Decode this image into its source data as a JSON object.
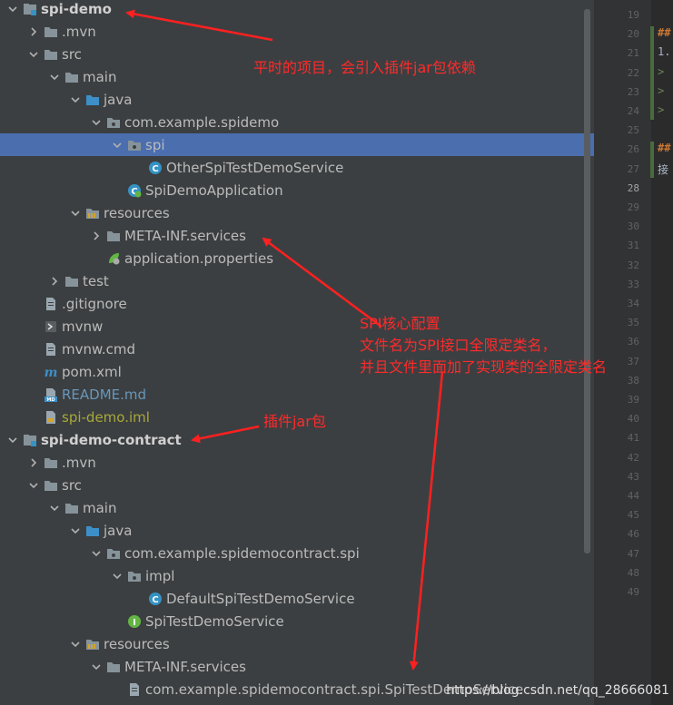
{
  "tree": {
    "rows": [
      {
        "label": "spi-demo",
        "kind": "module",
        "arrow": "down",
        "indent": 0,
        "style": "bold"
      },
      {
        "label": ".mvn",
        "kind": "folder",
        "arrow": "right",
        "indent": 1
      },
      {
        "label": "src",
        "kind": "folder",
        "arrow": "down",
        "indent": 1
      },
      {
        "label": "main",
        "kind": "folder",
        "arrow": "down",
        "indent": 2
      },
      {
        "label": "java",
        "kind": "src-folder",
        "arrow": "down",
        "indent": 3
      },
      {
        "label": "com.example.spidemo",
        "kind": "package",
        "arrow": "down",
        "indent": 4
      },
      {
        "label": "spi",
        "kind": "package",
        "arrow": "down",
        "indent": 5,
        "selected": true
      },
      {
        "label": "OtherSpiTestDemoService",
        "kind": "class",
        "arrow": "none",
        "indent": 6
      },
      {
        "label": "SpiDemoApplication",
        "kind": "app-class",
        "arrow": "none",
        "indent": 5
      },
      {
        "label": "resources",
        "kind": "res-folder",
        "arrow": "down",
        "indent": 3
      },
      {
        "label": "META-INF.services",
        "kind": "folder",
        "arrow": "right",
        "indent": 4
      },
      {
        "label": "application.properties",
        "kind": "properties",
        "arrow": "none",
        "indent": 4
      },
      {
        "label": "test",
        "kind": "folder",
        "arrow": "right",
        "indent": 2
      },
      {
        "label": ".gitignore",
        "kind": "file",
        "arrow": "none",
        "indent": 1
      },
      {
        "label": "mvnw",
        "kind": "script",
        "arrow": "none",
        "indent": 1
      },
      {
        "label": "mvnw.cmd",
        "kind": "file",
        "arrow": "none",
        "indent": 1
      },
      {
        "label": "pom.xml",
        "kind": "maven",
        "arrow": "none",
        "indent": 1
      },
      {
        "label": "README.md",
        "kind": "markdown",
        "arrow": "none",
        "indent": 1,
        "style": "blue"
      },
      {
        "label": "spi-demo.iml",
        "kind": "iml",
        "arrow": "none",
        "indent": 1,
        "style": "olive"
      },
      {
        "label": "spi-demo-contract",
        "kind": "module",
        "arrow": "down",
        "indent": 0,
        "style": "bold"
      },
      {
        "label": ".mvn",
        "kind": "folder",
        "arrow": "right",
        "indent": 1
      },
      {
        "label": "src",
        "kind": "folder",
        "arrow": "down",
        "indent": 1
      },
      {
        "label": "main",
        "kind": "folder",
        "arrow": "down",
        "indent": 2
      },
      {
        "label": "java",
        "kind": "src-folder",
        "arrow": "down",
        "indent": 3
      },
      {
        "label": "com.example.spidemocontract.spi",
        "kind": "package",
        "arrow": "down",
        "indent": 4
      },
      {
        "label": "impl",
        "kind": "package",
        "arrow": "down",
        "indent": 5
      },
      {
        "label": "DefaultSpiTestDemoService",
        "kind": "class",
        "arrow": "none",
        "indent": 6
      },
      {
        "label": "SpiTestDemoService",
        "kind": "interface",
        "arrow": "none",
        "indent": 5
      },
      {
        "label": "resources",
        "kind": "res-folder",
        "arrow": "down",
        "indent": 3
      },
      {
        "label": "META-INF.services",
        "kind": "folder",
        "arrow": "down",
        "indent": 4
      },
      {
        "label": "com.example.spidemocontract.spi.SpiTestDemoService",
        "kind": "file",
        "arrow": "none",
        "indent": 5
      }
    ]
  },
  "editor": {
    "line_numbers": [
      "19",
      "20",
      "21",
      "22",
      "23",
      "24",
      "25",
      "26",
      "27",
      "28",
      "29",
      "30",
      "31",
      "32",
      "33",
      "34",
      "35",
      "36",
      "37",
      "38",
      "39",
      "40",
      "41",
      "42",
      "43",
      "44",
      "45",
      "46",
      "47",
      "48",
      "49"
    ],
    "current_line": "28",
    "code_lines": [
      {
        "line": "20",
        "text": "##",
        "style": "hdr"
      },
      {
        "line": "21",
        "text": "1.",
        "style": "plain"
      },
      {
        "line": "22",
        "text": ">",
        "style": "quote"
      },
      {
        "line": "23",
        "text": ">",
        "style": "quote"
      },
      {
        "line": "24",
        "text": ">",
        "style": "quote"
      },
      {
        "line": "26",
        "text": "##",
        "style": "hdr"
      },
      {
        "line": "27",
        "text": "接",
        "style": "plain"
      }
    ]
  },
  "annotations": {
    "note_project": "平时的项目，会引入插件jar包依赖",
    "note_spi_1": "SPI核心配置",
    "note_spi_2": "文件名为SPI接口全限定类名，",
    "note_spi_3": "并且文件里面加了实现类的全限定类名",
    "note_plugin": "插件jar包"
  },
  "watermark": "https://blog.csdn.net/qq_28666081"
}
